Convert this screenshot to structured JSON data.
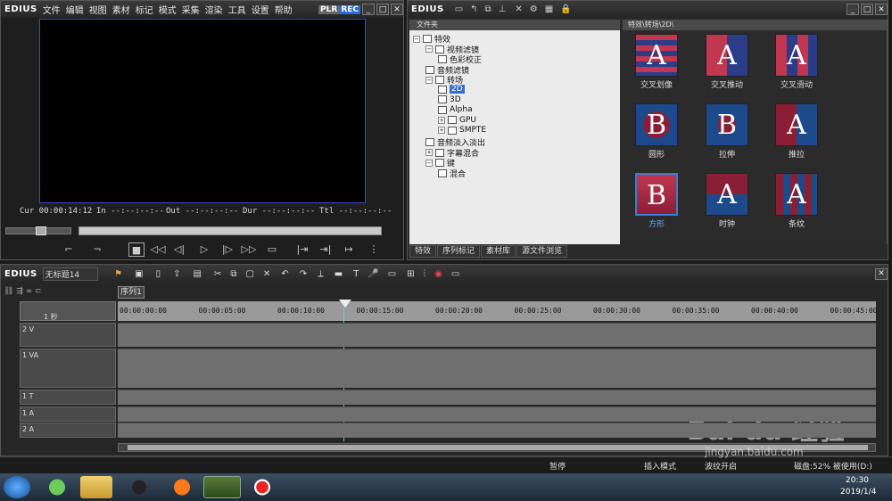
{
  "player": {
    "brand": "EDIUS",
    "menu": [
      "文件",
      "编辑",
      "视图",
      "素材",
      "标记",
      "模式",
      "采集",
      "渲染",
      "工具",
      "设置",
      "帮助"
    ],
    "plr": "PLR",
    "rec": "REC",
    "cur": "Cur 00:00:14:12",
    "in": "In --:--:--:--",
    "out": "Out --:--:--:--",
    "dur": "Dur --:--:--:--",
    "ttl": "Ttl --:--:--:--"
  },
  "effects": {
    "brand": "EDIUS",
    "tree_header": "文件夹",
    "grid_header": "特效\\转场\\2D\\",
    "tree": [
      {
        "label": "特效",
        "indent": 0,
        "exp": "⊟"
      },
      {
        "label": "视频滤镜",
        "indent": 1,
        "exp": "⊟"
      },
      {
        "label": "色彩校正",
        "indent": 2,
        "exp": ""
      },
      {
        "label": "音频滤镜",
        "indent": 1,
        "exp": ""
      },
      {
        "label": "转场",
        "indent": 1,
        "exp": "⊟"
      },
      {
        "label": "2D",
        "indent": 2,
        "exp": "",
        "selected": true
      },
      {
        "label": "3D",
        "indent": 2,
        "exp": ""
      },
      {
        "label": "Alpha",
        "indent": 2,
        "exp": ""
      },
      {
        "label": "GPU",
        "indent": 2,
        "exp": "⊞"
      },
      {
        "label": "SMPTE",
        "indent": 2,
        "exp": "⊞"
      },
      {
        "label": "音频淡入淡出",
        "indent": 1,
        "exp": ""
      },
      {
        "label": "字幕混合",
        "indent": 1,
        "exp": "⊞"
      },
      {
        "label": "键",
        "indent": 1,
        "exp": "⊟"
      },
      {
        "label": "混合",
        "indent": 2,
        "exp": ""
      }
    ],
    "items": [
      "交叉划像",
      "交叉推动",
      "交叉滑动",
      "圆形",
      "拉伸",
      "推拉",
      "方形",
      "时钟",
      "条纹"
    ],
    "tabs": [
      "特效",
      "序列标记",
      "素材库",
      "源文件浏览"
    ]
  },
  "timeline": {
    "brand": "EDIUS",
    "project": "无标题14",
    "sequence_tab": "序列1",
    "scale": "1 秒",
    "ticks": [
      "00:00:00:00",
      "00:00:05:00",
      "00:00:10:00",
      "00:00:15:00",
      "00:00:20:00",
      "00:00:25:00",
      "00:00:30:00",
      "00:00:35:00",
      "00:00:40:00",
      "00:00:45:00"
    ],
    "tracks": [
      "2 V",
      "1 VA",
      "1 T",
      "1 A",
      "2 A"
    ]
  },
  "status": {
    "stop": "暂停",
    "insert": "插入模式",
    "ripple": "波纹开启",
    "disk": "磁盘:52% 被使用(D:)"
  },
  "taskbar": {
    "time": "20:30",
    "date": "2019/1/4"
  },
  "watermark": {
    "text": "Bai du 经验",
    "url": "jingyan.baidu.com"
  }
}
